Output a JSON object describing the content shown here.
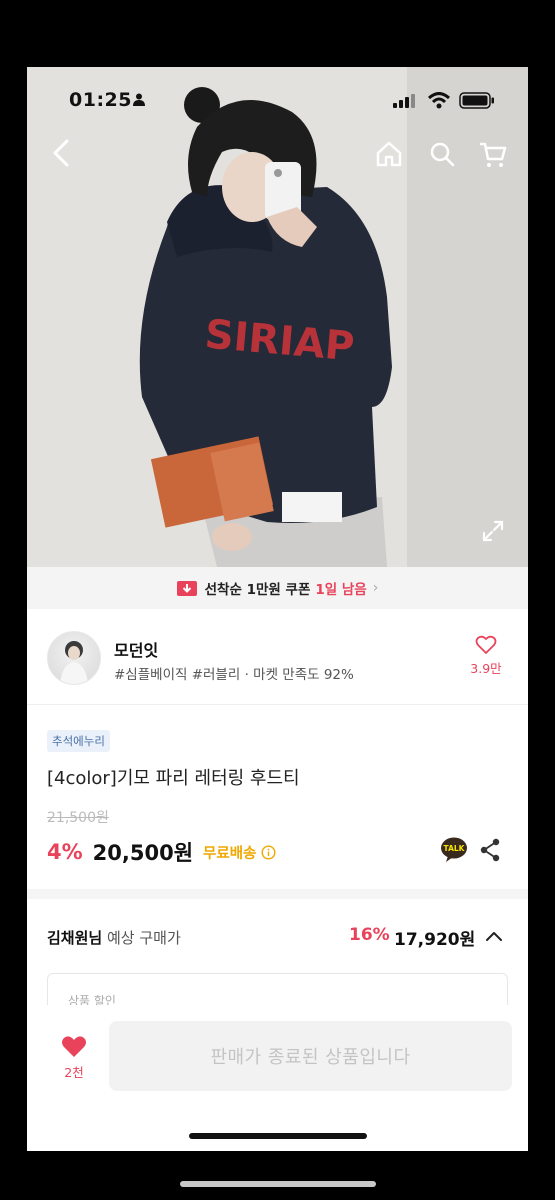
{
  "status_bar": {
    "time": "01:25"
  },
  "coupon": {
    "text": "선착순 1만원 쿠폰",
    "remaining": "1일 남음"
  },
  "shop": {
    "name": "모던잇",
    "tags": "#심플베이직 #러블리 · 마켓 만족도 92%",
    "favorite_count": "3.9만"
  },
  "product": {
    "badge": "추석에누리",
    "title": "[4color]기모 파리 레터링 후드티",
    "original_price": "21,500원",
    "discount_rate": "4%",
    "price": "20,500원",
    "shipping": "무료배송"
  },
  "expected_price": {
    "user": "김채원님",
    "label": "예상 구매가",
    "rate": "16%",
    "amount": "17,920원"
  },
  "discount_box": {
    "label": "상품 할인"
  },
  "bottom_bar": {
    "like_count": "2천",
    "button_label": "판매가 종료된 상품입니다"
  },
  "colors": {
    "accent": "#e8435b",
    "shipping": "#f0a800",
    "badge_bg": "#eaf1fb"
  },
  "icons": [
    "person-icon",
    "signal-icon",
    "wifi-icon",
    "battery-icon",
    "back-icon",
    "home-icon",
    "search-icon",
    "cart-icon",
    "expand-icon",
    "coupon-icon",
    "heart-icon",
    "info-icon",
    "talk-icon",
    "share-icon",
    "chevron-up-icon"
  ]
}
